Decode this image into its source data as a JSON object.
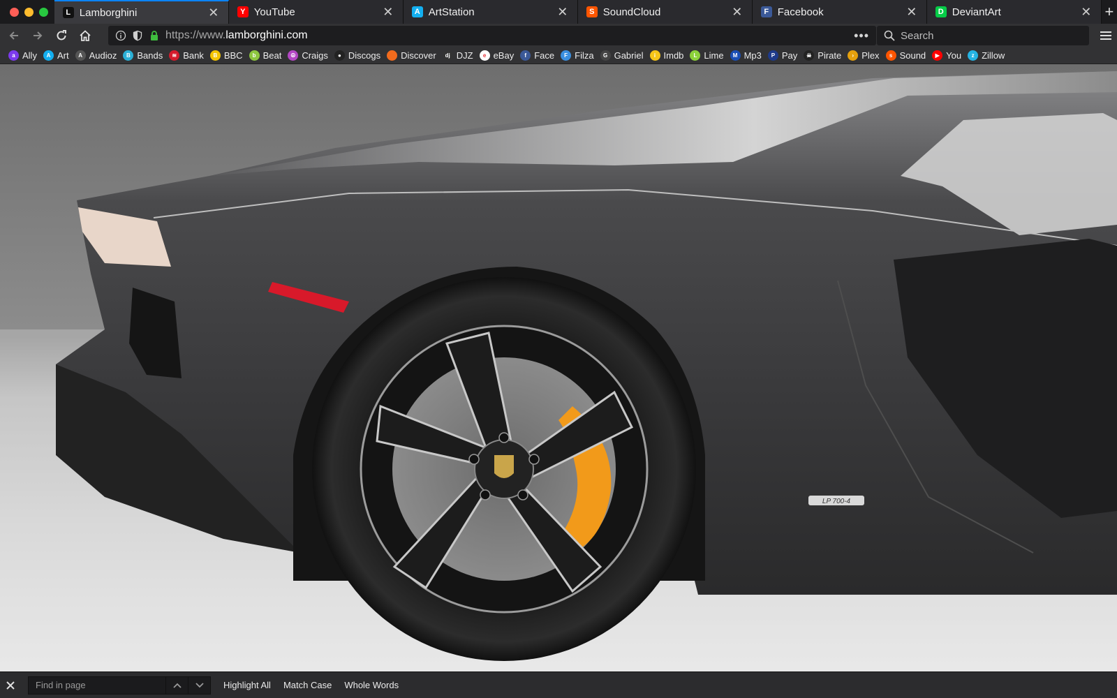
{
  "tabs": [
    {
      "title": "Lamborghini",
      "favicon": "lamborghini-shield-icon",
      "active": true,
      "color": "#111111"
    },
    {
      "title": "YouTube",
      "favicon": "youtube-icon",
      "active": false,
      "color": "#ff0000"
    },
    {
      "title": "ArtStation",
      "favicon": "artstation-icon",
      "active": false,
      "color": "#13aff0"
    },
    {
      "title": "SoundCloud",
      "favicon": "soundcloud-icon",
      "active": false,
      "color": "#ff5500"
    },
    {
      "title": "Facebook",
      "favicon": "facebook-icon",
      "active": false,
      "color": "#3b5998"
    },
    {
      "title": "DeviantArt",
      "favicon": "deviantart-icon",
      "active": false,
      "color": "#05cc47"
    }
  ],
  "navbar": {
    "url_prefix": "https://www.",
    "url_domain": "lamborghini.com",
    "more_label": "•••",
    "search_placeholder": "Search"
  },
  "bookmarks": [
    {
      "label": "Ally",
      "icon": "ally-icon",
      "color": "#7c3aed",
      "glyph": "a"
    },
    {
      "label": "Art",
      "icon": "artstation-icon",
      "color": "#13aff0",
      "glyph": "A"
    },
    {
      "label": "Audioz",
      "icon": "audioz-icon",
      "color": "#555555",
      "glyph": "A"
    },
    {
      "label": "Bands",
      "icon": "bandcamp-icon",
      "color": "#2bb0d6",
      "glyph": "B"
    },
    {
      "label": "Bank",
      "icon": "bank-icon",
      "color": "#d41b2c",
      "glyph": "≋"
    },
    {
      "label": "BBC",
      "icon": "bbc-icon",
      "color": "#f4c400",
      "glyph": "B"
    },
    {
      "label": "Beat",
      "icon": "beatport-icon",
      "color": "#8dc63f",
      "glyph": "b"
    },
    {
      "label": "Craigs",
      "icon": "peace-icon",
      "color": "#b347c4",
      "glyph": "☮"
    },
    {
      "label": "Discogs",
      "icon": "discogs-icon",
      "color": "#222222",
      "glyph": "●"
    },
    {
      "label": "Discover",
      "icon": "discover-icon",
      "color": "#f26b1d",
      "glyph": ""
    },
    {
      "label": "DJZ",
      "icon": "djz-icon",
      "color": "#333333",
      "glyph": "dj"
    },
    {
      "label": "eBay",
      "icon": "ebay-icon",
      "color": "#ffffff",
      "glyph": "e"
    },
    {
      "label": "Face",
      "icon": "facebook-icon",
      "color": "#3b5998",
      "glyph": "f"
    },
    {
      "label": "Filza",
      "icon": "filza-icon",
      "color": "#3a8fe0",
      "glyph": "F"
    },
    {
      "label": "Gabriel",
      "icon": "gabriel-icon",
      "color": "#444444",
      "glyph": "G"
    },
    {
      "label": "Imdb",
      "icon": "imdb-icon",
      "color": "#f5c518",
      "glyph": "i"
    },
    {
      "label": "Lime",
      "icon": "lime-icon",
      "color": "#8cd13a",
      "glyph": "L"
    },
    {
      "label": "Mp3",
      "icon": "mp3-icon",
      "color": "#1a4fb5",
      "glyph": "M"
    },
    {
      "label": "Pay",
      "icon": "paypal-icon",
      "color": "#1e3a8a",
      "glyph": "P"
    },
    {
      "label": "Pirate",
      "icon": "pirate-icon",
      "color": "#222222",
      "glyph": "☠"
    },
    {
      "label": "Plex",
      "icon": "plex-icon",
      "color": "#e5a00d",
      "glyph": "›"
    },
    {
      "label": "Sound",
      "icon": "soundcloud-icon",
      "color": "#ff5500",
      "glyph": "s"
    },
    {
      "label": "You",
      "icon": "youtube-icon",
      "color": "#ff0000",
      "glyph": "▶"
    },
    {
      "label": "Zillow",
      "icon": "zillow-icon",
      "color": "#25b3e3",
      "glyph": "z"
    }
  ],
  "findbar": {
    "placeholder": "Find in page",
    "highlight_all": "Highlight All",
    "match_case": "Match Case",
    "whole_words": "Whole Words"
  },
  "content": {
    "image": "lamborghini-aventador-side-view",
    "badge_text": "LP 700-4"
  },
  "colors": {
    "tab_active_accent": "#0a84ff",
    "lock_green": "#3fbd3f",
    "caliper_orange": "#f29a1a",
    "car_body": "#3a3a3c"
  }
}
